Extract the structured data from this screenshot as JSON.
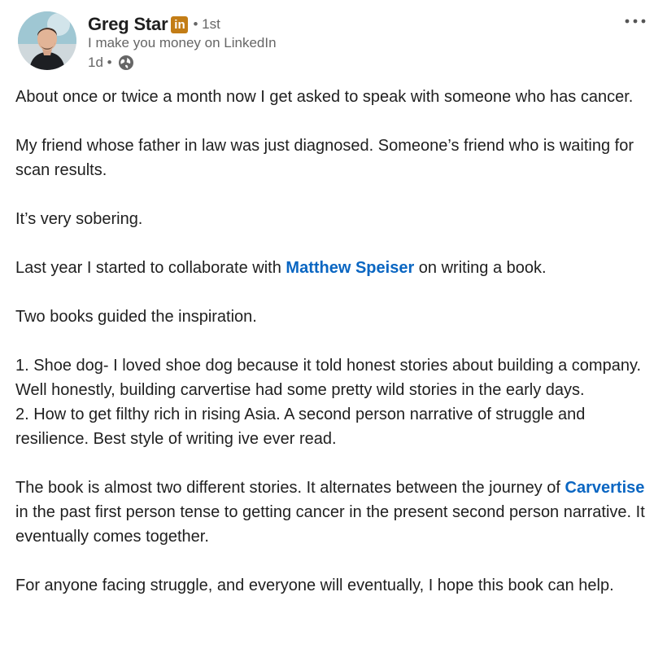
{
  "author": {
    "name": "Greg Star",
    "badge": "in",
    "degree": "• 1st",
    "headline": "I make you money on LinkedIn",
    "time": "1d •"
  },
  "post": {
    "p1": "About once or twice a month now I get asked to speak with someone who has cancer.",
    "p2": "My friend whose father in law was just diagnosed. Someone’s friend who is waiting for scan results.",
    "p3": "It’s very sobering.",
    "p4_before": "Last year I started to collaborate with ",
    "p4_mention": "Matthew Speiser",
    "p4_after": " on writing a book.",
    "p5": "Two books guided the inspiration.",
    "p6_line1": "1. Shoe dog- I loved shoe dog because it told honest stories about building a company. Well honestly, building carvertise had some pretty wild stories in the early days.",
    "p6_line2": "2. How to get filthy rich in rising Asia. A second person narrative of struggle and resilience. Best style of writing ive ever read.",
    "p7_before": "The book is almost two different stories. It alternates between the journey of ",
    "p7_mention": "Carvertise",
    "p7_after": " in the past first person tense to getting cancer in the present second person narrative. It eventually comes together.",
    "p8": "For anyone facing struggle, and everyone will eventually, I hope this book can help."
  },
  "icons": {
    "more": "more-options-icon",
    "globe": "globe-icon",
    "avatar": "profile-photo"
  },
  "colors": {
    "mention": "#0a66c2",
    "badge": "#c37d16",
    "text": "#1f1f1f",
    "muted": "#666666"
  }
}
